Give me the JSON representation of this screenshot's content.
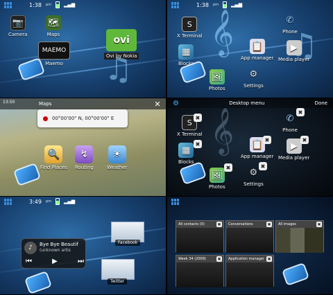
{
  "panels": {
    "home1": {
      "time": "1:38",
      "ampm": "pm",
      "icons": [
        "Camera",
        "Maps",
        "Maemo",
        "Ovi by Nokia"
      ],
      "ovi_logo": "ovi"
    },
    "home2": {
      "time": "1:38",
      "ampm": "pm",
      "icons": [
        "X Terminal",
        "Phone",
        "Blocks",
        "App manager",
        "Media player",
        "Photos",
        "Settings"
      ]
    },
    "maps": {
      "title": "Maps",
      "time": "13:50",
      "coordinates": "00°00'00\" N, 00°00'00\" E",
      "icons": [
        "Find Places",
        "Routing",
        "Weather"
      ]
    },
    "desktop_menu": {
      "title": "Desktop menu",
      "done": "Done",
      "icons": [
        "X Terminal",
        "Phone",
        "Blocks",
        "App manager",
        "Media player",
        "Photos",
        "Settings"
      ]
    },
    "home3": {
      "time": "3:49",
      "ampm": "pm",
      "song_title": "Bye Bye Beautif",
      "artist": "(unknown artis",
      "widgets": [
        "Facebook",
        "Twitter"
      ]
    },
    "dashboard": {
      "cards": [
        "All contacts (0)",
        "Conversations",
        "All images",
        "Week 34 (2009)",
        "Application manager"
      ]
    }
  },
  "colors": {
    "accent": "#3a8fe0",
    "ovi_green": "#5fb83a"
  }
}
